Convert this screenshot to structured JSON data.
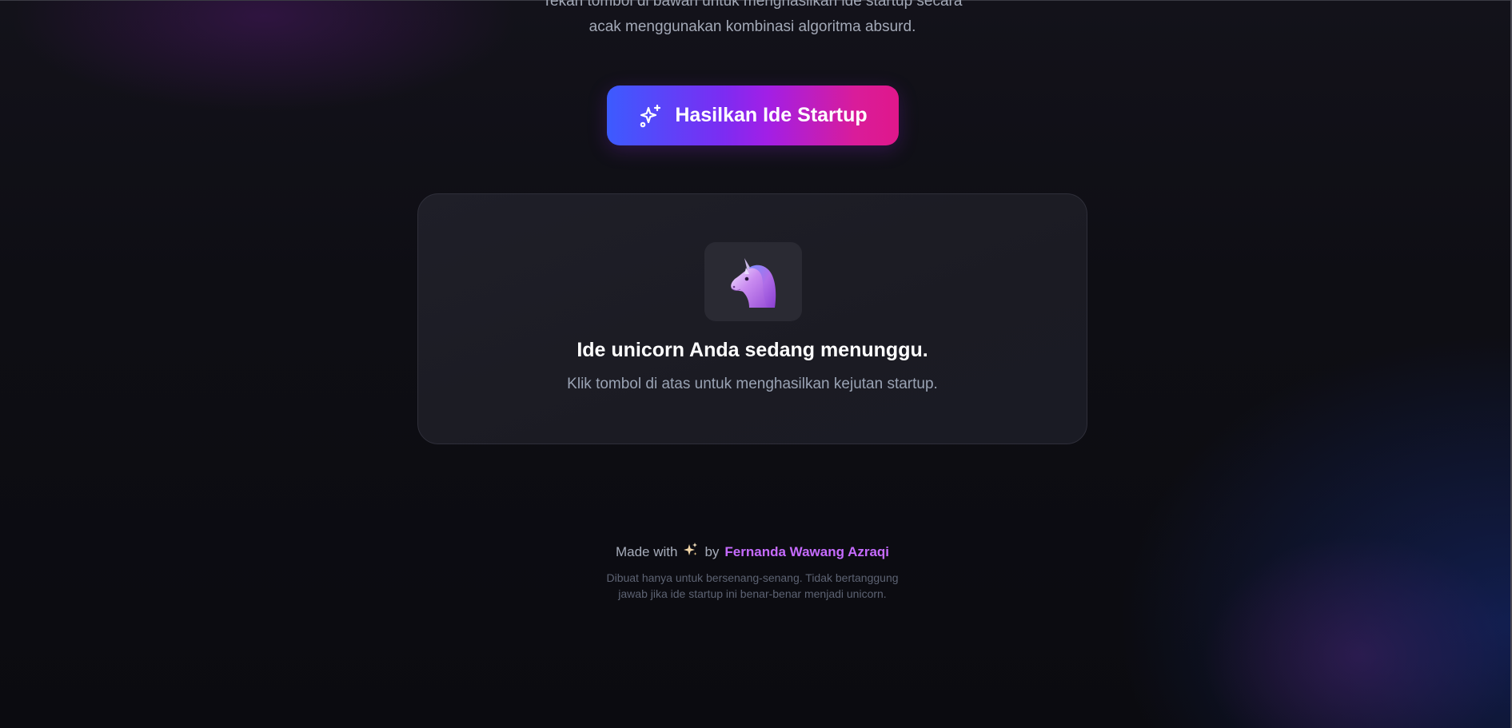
{
  "intro": {
    "line1": "Tekan tombol di bawah untuk menghasilkan ide startup secara",
    "line2": "acak menggunakan kombinasi algoritma absurd."
  },
  "generate_button": {
    "label": "Hasilkan Ide Startup",
    "icon": "sparkles-icon"
  },
  "idea_card": {
    "icon": "unicorn-icon",
    "title": "Ide unicorn Anda sedang menunggu.",
    "subtitle": "Klik tombol di atas untuk menghasilkan kejutan startup."
  },
  "footer": {
    "made_with": "Made with",
    "by": "by",
    "author": "Fernanda Wawang Azraqi",
    "disclaimer_line1": "Dibuat hanya untuk bersenang-senang. Tidak bertanggung",
    "disclaimer_line2": "jawab jika ide startup ini benar-benar menjadi unicorn."
  },
  "colors": {
    "button_gradient_start": "#3c5bff",
    "button_gradient_mid": "#a21fe6",
    "button_gradient_end": "#e0178b",
    "author_link": "#c66bff",
    "background": "#0c0c11"
  }
}
